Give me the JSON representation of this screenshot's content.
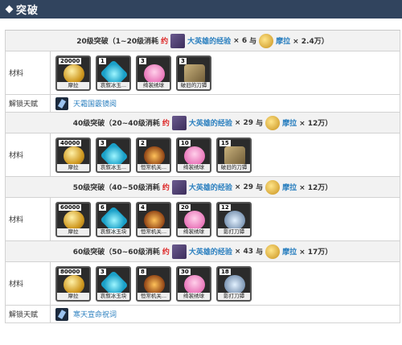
{
  "page_title": "突破",
  "sections": [
    {
      "header": {
        "prefix": "20级突破（1~20级消耗",
        "yue": "约",
        "hero_exp": "大英雄的经验",
        "hero_qty": "× 6",
        "yu": "与",
        "mora": "摩拉",
        "mora_qty": "× 2.4万）"
      },
      "label": "材料",
      "items": [
        {
          "count": "20000",
          "name": "摩拉",
          "art": "coin"
        },
        {
          "count": "1",
          "name": "哀叙冰玉...",
          "art": "ice"
        },
        {
          "count": "3",
          "name": "绮裳绣球",
          "art": "pink"
        },
        {
          "count": "3",
          "name": "破旧的刀镡",
          "art": "blade"
        }
      ],
      "talent": {
        "label": "解锁天赋",
        "name": "天霜国霰镜阅"
      }
    },
    {
      "header": {
        "prefix": "40级突破（20~40级消耗",
        "yue": "约",
        "hero_exp": "大英雄的经验",
        "hero_qty": "× 29",
        "yu": "与",
        "mora": "摩拉",
        "mora_qty": "× 12万）"
      },
      "label": "材料",
      "items": [
        {
          "count": "40000",
          "name": "摩拉",
          "art": "coin"
        },
        {
          "count": "3",
          "name": "哀叙冰玉...",
          "art": "ice"
        },
        {
          "count": "2",
          "name": "恒常机关...",
          "art": "mech"
        },
        {
          "count": "10",
          "name": "绮裳绣球",
          "art": "pink"
        },
        {
          "count": "15",
          "name": "破旧的刀镡",
          "art": "blade"
        }
      ]
    },
    {
      "header": {
        "prefix": "50级突破（40~50级消耗",
        "yue": "约",
        "hero_exp": "大英雄的经验",
        "hero_qty": "× 29",
        "yu": "与",
        "mora": "摩拉",
        "mora_qty": "× 12万）"
      },
      "label": "材料",
      "items": [
        {
          "count": "60000",
          "name": "摩拉",
          "art": "coin"
        },
        {
          "count": "6",
          "name": "哀叙冰玉块",
          "art": "ice"
        },
        {
          "count": "4",
          "name": "恒常机关...",
          "art": "mech"
        },
        {
          "count": "20",
          "name": "绮裳绣球",
          "art": "pink"
        },
        {
          "count": "12",
          "name": "影打刀镡",
          "art": "steel"
        }
      ]
    },
    {
      "header": {
        "prefix": "60级突破（50~60级消耗",
        "yue": "约",
        "hero_exp": "大英雄的经验",
        "hero_qty": "× 43",
        "yu": "与",
        "mora": "摩拉",
        "mora_qty": "× 17万）"
      },
      "label": "材料",
      "items": [
        {
          "count": "80000",
          "name": "摩拉",
          "art": "coin"
        },
        {
          "count": "3",
          "name": "哀叙冰玉块",
          "art": "ice"
        },
        {
          "count": "8",
          "name": "恒常机关...",
          "art": "mech"
        },
        {
          "count": "30",
          "name": "绮裳绣球",
          "art": "pink"
        },
        {
          "count": "18",
          "name": "影打刀镡",
          "art": "steel"
        }
      ],
      "talent": {
        "label": "解锁天赋",
        "name": "寒天宣命祝词"
      }
    }
  ]
}
